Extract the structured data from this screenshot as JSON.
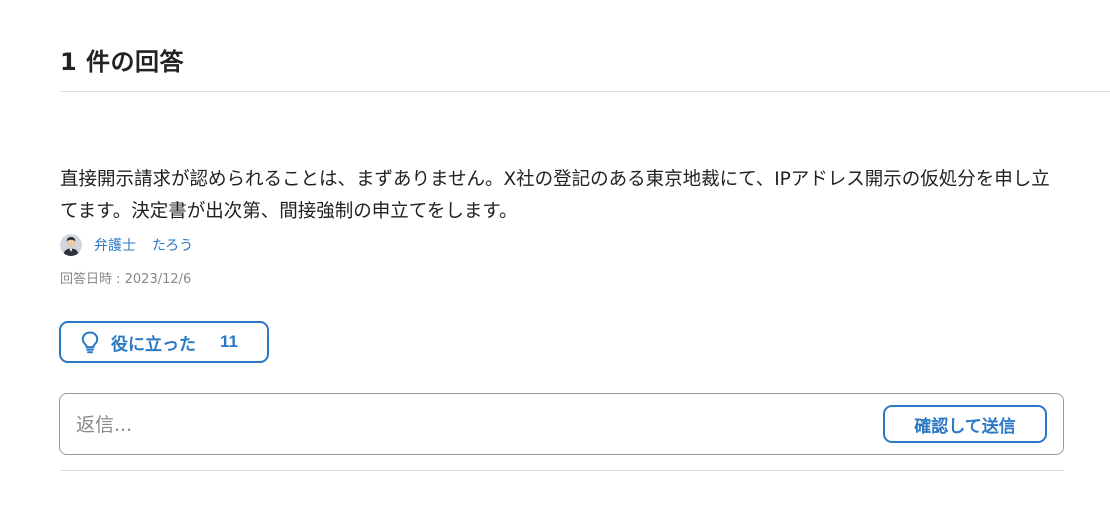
{
  "answers": {
    "heading": "1 件の回答"
  },
  "answer": {
    "body": "直接開示請求が認められることは、まずありません。X社の登記のある東京地裁にて、IPアドレス開示の仮処分を申し立てます。決定書が出次第、間接強制の申立てをします。",
    "author_title": "弁護士",
    "author_name": "たろう",
    "answered_at": "回答日時 : 2023/12/6",
    "helpful_label": "役に立った",
    "helpful_count": "11"
  },
  "reply": {
    "placeholder": "返信...",
    "submit_label": "確認して送信"
  },
  "colors": {
    "accent": "#2b78c5",
    "muted": "#888888",
    "divider": "#dddddd"
  },
  "icons": {
    "helpful": "lightbulb-icon",
    "avatar": "avatar"
  }
}
